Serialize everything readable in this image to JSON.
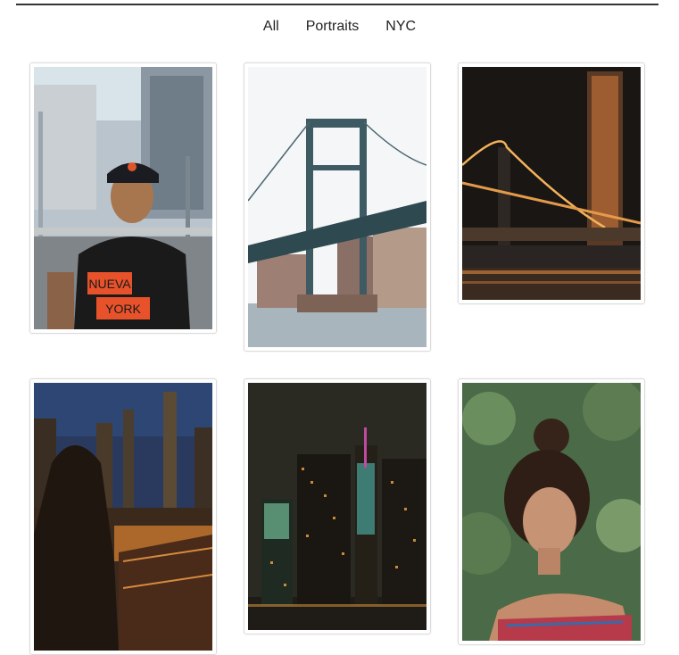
{
  "filters": [
    "All",
    "Portraits",
    "NYC"
  ],
  "photos": [
    {
      "name": "photo-man-flyers-cap"
    },
    {
      "name": "photo-manhattan-bridge-day"
    },
    {
      "name": "photo-bridge-night-tower"
    },
    {
      "name": "photo-woman-skyline-night"
    },
    {
      "name": "photo-skyline-night-water"
    },
    {
      "name": "photo-woman-portrait-trees"
    }
  ],
  "shirt_text": [
    "NUEVA",
    "YORK"
  ]
}
